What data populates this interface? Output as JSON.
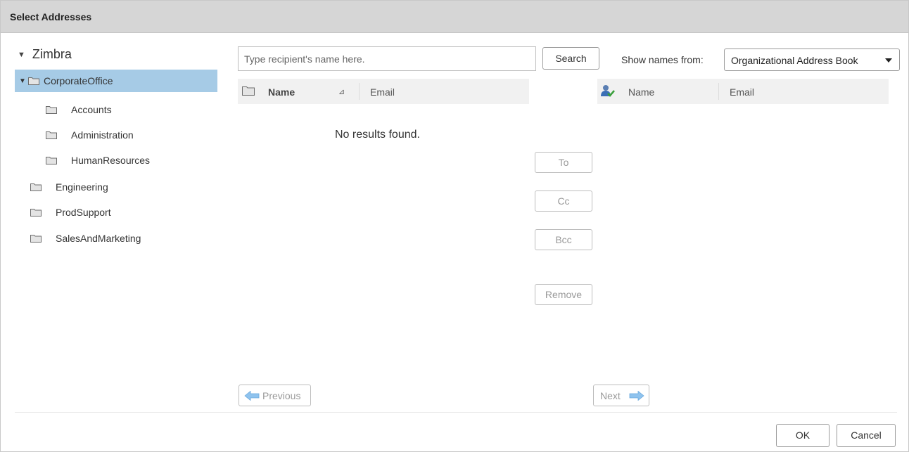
{
  "dialog": {
    "title": "Select Addresses"
  },
  "tree": {
    "root": "Zimbra",
    "items": [
      {
        "label": "CorporateOffice",
        "selected": true,
        "expanded": true
      },
      {
        "label": "Accounts"
      },
      {
        "label": "Administration"
      },
      {
        "label": "HumanResources"
      },
      {
        "label": "Engineering"
      },
      {
        "label": "ProdSupport"
      },
      {
        "label": "SalesAndMarketing"
      }
    ]
  },
  "search": {
    "placeholder": "Type recipient's name here.",
    "button": "Search",
    "show_names_label": "Show names from:",
    "source": "Organizational Address Book"
  },
  "results": {
    "col_name": "Name",
    "col_email": "Email",
    "empty_text": "No results found.",
    "previous": "Previous",
    "next": "Next"
  },
  "actions": {
    "to": "To",
    "cc": "Cc",
    "bcc": "Bcc",
    "remove": "Remove"
  },
  "selected": {
    "col_name": "Name",
    "col_email": "Email"
  },
  "footer": {
    "ok": "OK",
    "cancel": "Cancel"
  },
  "colors": {
    "titlebar": "#d6d6d6",
    "selection": "#a6cbe6",
    "header": "#f1f1f1",
    "nav_arrow": "#8fc3ee"
  }
}
